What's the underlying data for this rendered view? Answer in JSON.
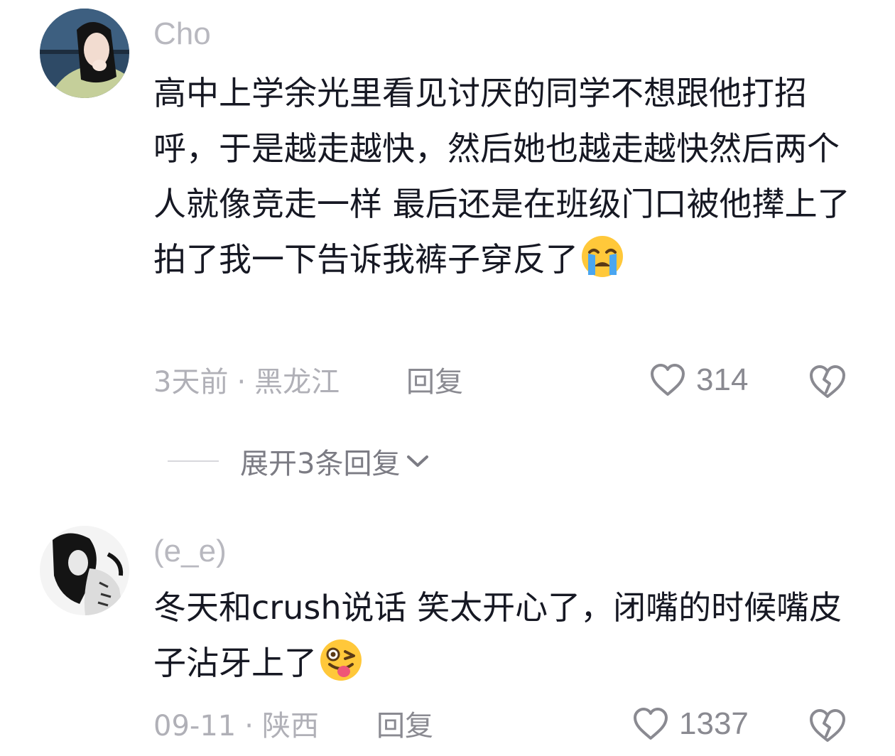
{
  "comments": [
    {
      "username": "Cho",
      "text": "高中上学余光里看见讨厌的同学不想跟他打招呼，于是越走越快，然后她也越走越快然后两个人就像竞走一样 最后还是在班级门口被他撵上了拍了我一下告诉我裤子穿反了",
      "emoji": "loudly-crying-face-emoji",
      "time": "3天前",
      "separator": "·",
      "location": "黑龙江",
      "reply_label": "回复",
      "likes": "314",
      "heart_icon": "heart-outline-icon",
      "dislike_icon": "broken-heart-icon"
    },
    {
      "username": "(e_e)",
      "text": "冬天和crush说话 笑太开心了，闭嘴的时候嘴皮子沾牙上了",
      "emoji": "winking-tongue-face-emoji",
      "time": "09-11",
      "separator": "·",
      "location": "陕西",
      "reply_label": "回复",
      "likes": "1337",
      "heart_icon": "heart-outline-icon",
      "dislike_icon": "broken-heart-icon"
    }
  ],
  "expand_replies": {
    "label": "展开3条回复",
    "icon": "chevron-down-icon"
  },
  "colors": {
    "text": "#161823",
    "muted": "#b0b0b7",
    "icon": "#8a8a91",
    "emoji_yellow": "#ffc83a",
    "tear_blue": "#4aa6f0"
  }
}
